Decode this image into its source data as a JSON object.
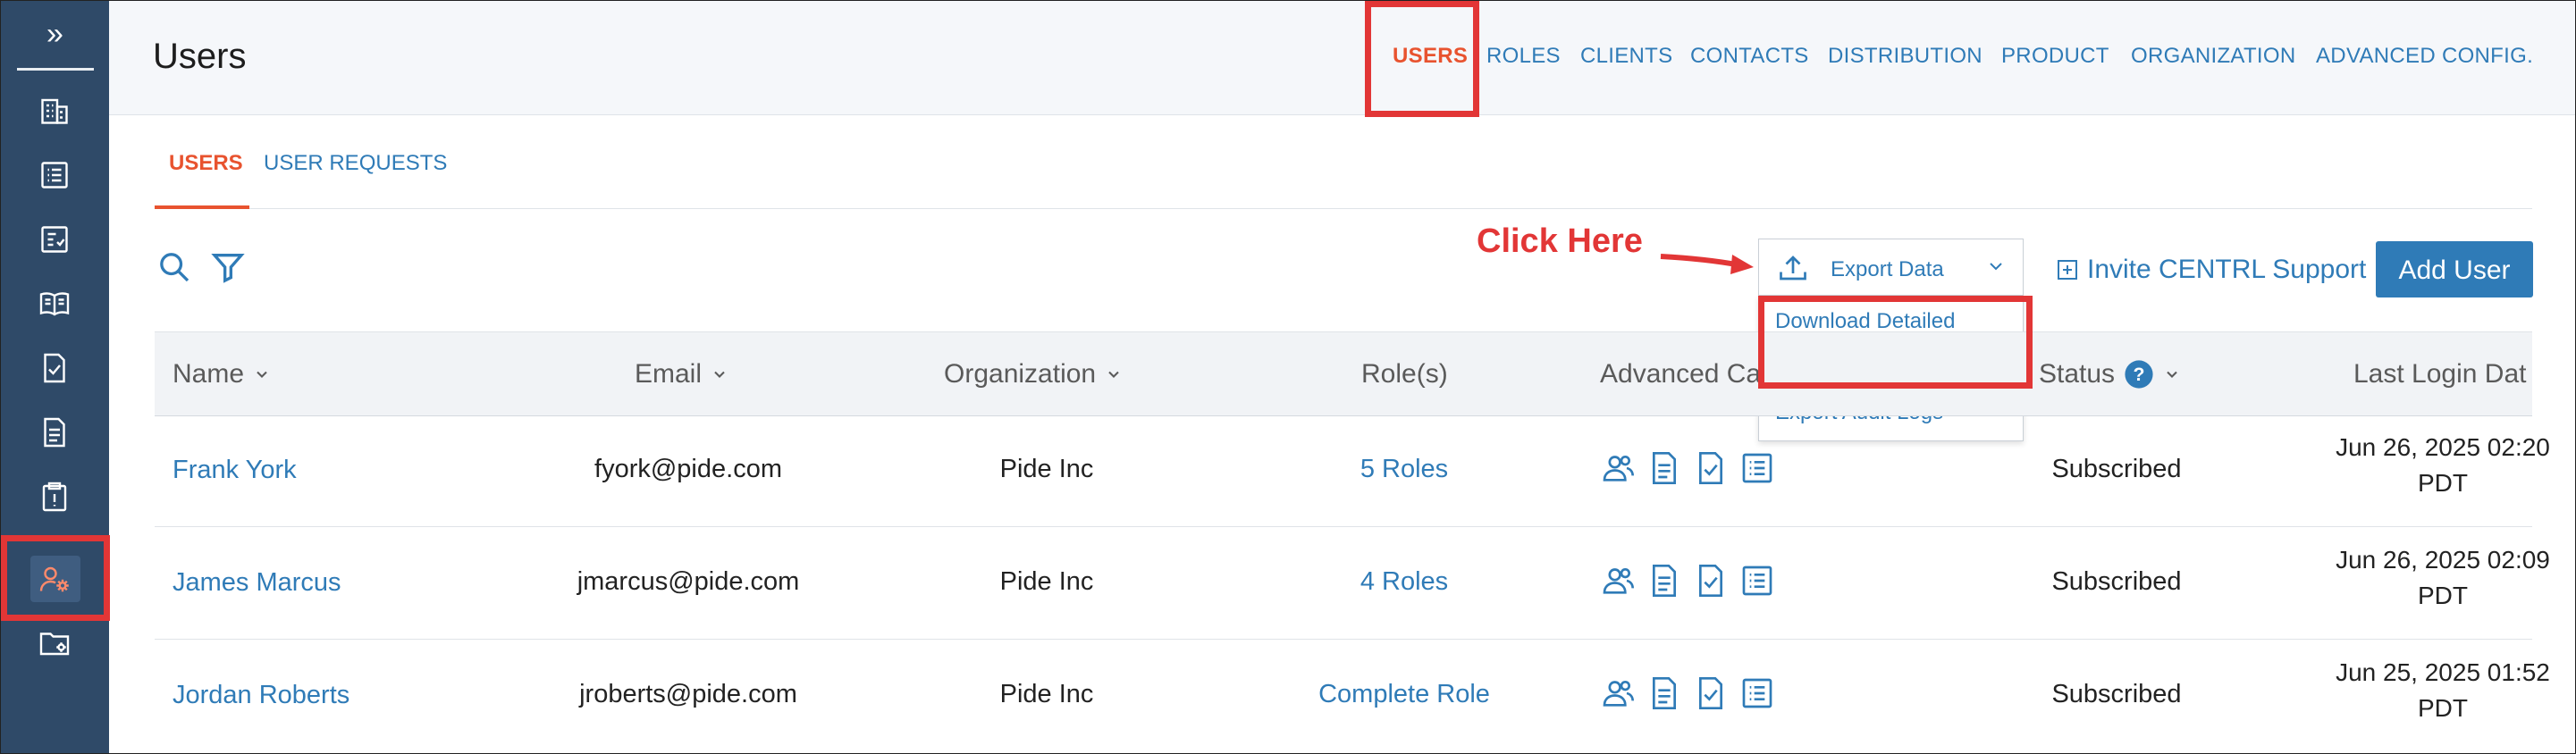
{
  "sidebar": {
    "expand_glyph": "»",
    "icons": [
      "building-icon",
      "list-icon",
      "checklist-icon",
      "book-icon",
      "document-check-icon",
      "document-icon",
      "clipboard-alert-icon",
      "user-settings-icon",
      "folder-settings-icon"
    ],
    "active_icon": "user-settings-icon"
  },
  "header": {
    "title": "Users",
    "nav": [
      "USERS",
      "ROLES",
      "CLIENTS",
      "CONTACTS",
      "DISTRIBUTION",
      "PRODUCT",
      "ORGANIZATION",
      "ADVANCED CONFIG."
    ],
    "active": "USERS"
  },
  "subtabs": [
    "USERS",
    "USER REQUESTS"
  ],
  "toolbar": {
    "export_label": "Export Data",
    "dropdown": [
      "Download Detailed Report",
      "Export Audit Logs"
    ],
    "invite_label": "Invite CENTRL Support",
    "add_user_label": "Add User"
  },
  "annotation": {
    "text": "Click Here",
    "color": "#e23636"
  },
  "table": {
    "headers": [
      "Name",
      "Email",
      "Organization",
      "Role(s)",
      "Advanced Ca",
      "Status",
      "Last Login Dat"
    ],
    "rows": [
      {
        "name": "Frank York",
        "email": "fyork@pide.com",
        "org": "Pide Inc",
        "roles": "5 Roles",
        "status": "Subscribed",
        "login_1": "Jun 26, 2025 02:20",
        "login_2": "PDT"
      },
      {
        "name": "James Marcus",
        "email": "jmarcus@pide.com",
        "org": "Pide Inc",
        "roles": "4 Roles",
        "status": "Subscribed",
        "login_1": "Jun 26, 2025 02:09",
        "login_2": "PDT"
      },
      {
        "name": "Jordan Roberts",
        "email": "jroberts@pide.com",
        "org": "Pide Inc",
        "roles": "Complete Role",
        "status": "Subscribed",
        "login_1": "Jun 25, 2025 01:52",
        "login_2": "PDT"
      }
    ]
  },
  "colors": {
    "sidebar": "#2f4a68",
    "link": "#2f7bb7",
    "active": "#e8532f",
    "button": "#2f7bb7"
  }
}
